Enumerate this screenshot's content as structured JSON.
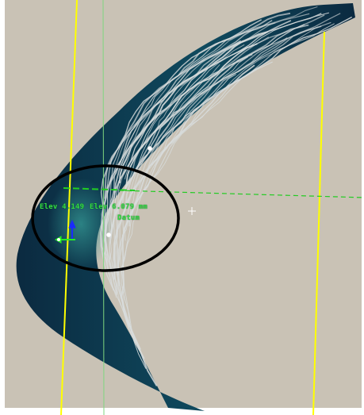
{
  "viewport": {
    "background": "#c9c2b5",
    "frame_color": "#ffffff"
  },
  "colors": {
    "surface_dark": "#0b2a40",
    "surface_mid": "#0f4a5e",
    "surface_highlight": "#2f8a8a",
    "fiber": "#d8dcdc",
    "guide_yellow": "#ffff00",
    "guide_green": "#7fd67f",
    "dashed_green": "#22cc22",
    "circle": "#000000",
    "axis_blue": "#1a2aff",
    "axis_green": "#22ee22"
  },
  "annotations": {
    "elev_left": "Elev 4.149",
    "elev_right": "Elev 6.079 mm",
    "datum": "Datum"
  },
  "icons": {
    "crosshair": "crosshair-icon",
    "axis_gizmo": "axis-gizmo-icon",
    "point_marker": "point-marker-icon"
  }
}
